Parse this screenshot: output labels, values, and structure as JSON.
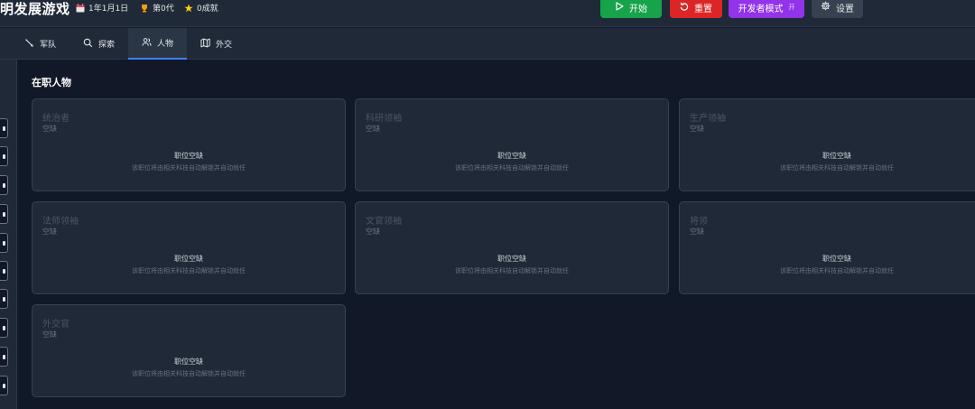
{
  "header": {
    "title": "明发展游戏",
    "date": "1年1月1日",
    "generation": "第0代",
    "achievements": "0成就",
    "start_label": "开始",
    "reset_label": "重置",
    "dev_label": "开发者模式",
    "dev_badge": "开",
    "settings_label": "设置",
    "colors": {
      "start": "#16a34a",
      "reset": "#dc2626",
      "dev": "#9333ea",
      "settings": "#374151"
    }
  },
  "tabs": [
    {
      "label": "军队",
      "icon": "sword-icon",
      "active": false
    },
    {
      "label": "探索",
      "icon": "search-icon",
      "active": false
    },
    {
      "label": "人物",
      "icon": "users-icon",
      "active": true
    },
    {
      "label": "外交",
      "icon": "map-icon",
      "active": false
    }
  ],
  "main": {
    "section_title": "在职人物",
    "cards": [
      {
        "role": "统治者",
        "status": "空缺",
        "empty_title": "职位空缺",
        "empty_note": "该职位将由相关科技自动解锁并自动就任"
      },
      {
        "role": "科研领袖",
        "status": "空缺",
        "empty_title": "职位空缺",
        "empty_note": "该职位将由相关科技自动解锁并自动就任"
      },
      {
        "role": "生产领袖",
        "status": "空缺",
        "empty_title": "职位空缺",
        "empty_note": "该职位将由相关科技自动解锁并自动就任"
      },
      {
        "role": "法师领袖",
        "status": "空缺",
        "empty_title": "职位空缺",
        "empty_note": "该职位将由相关科技自动解锁并自动就任"
      },
      {
        "role": "文官领袖",
        "status": "空缺",
        "empty_title": "职位空缺",
        "empty_note": "该职位将由相关科技自动解锁并自动就任"
      },
      {
        "role": "将领",
        "status": "空缺",
        "empty_title": "职位空缺",
        "empty_note": "该职位将由相关科技自动解锁并自动就任"
      },
      {
        "role": "外交官",
        "status": "空缺",
        "empty_title": "职位空缺",
        "empty_note": "该职位将由相关科技自动解锁并自动就任"
      }
    ]
  }
}
